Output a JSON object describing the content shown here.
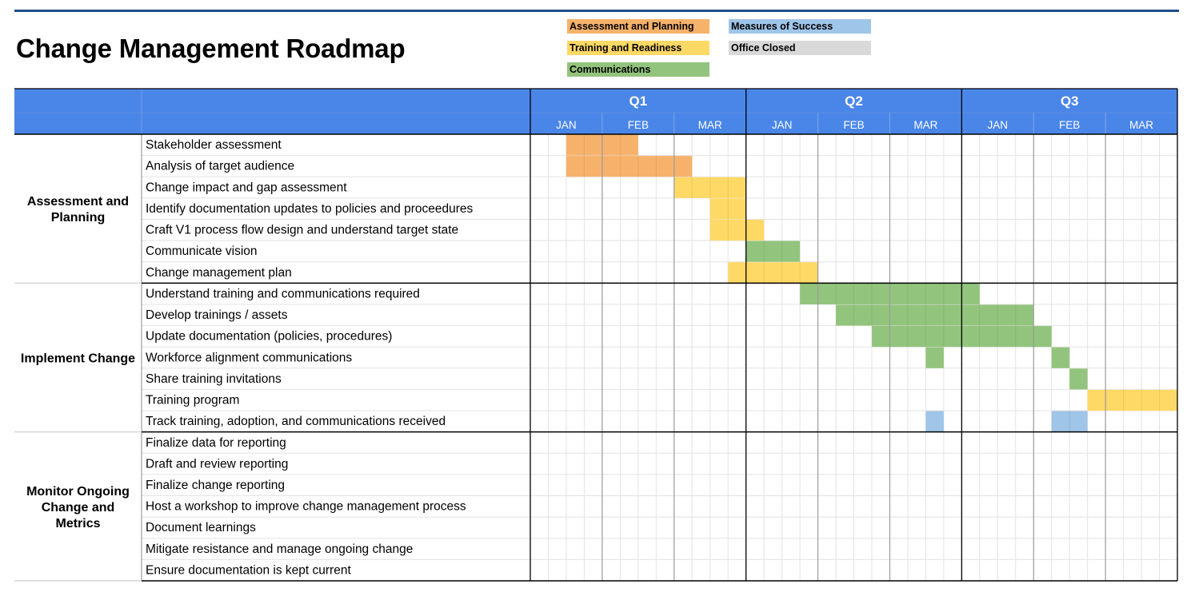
{
  "title": "Change Management Roadmap",
  "legend": [
    {
      "label": "Assessment and Planning",
      "key": "assessment",
      "color": "#f6b26b"
    },
    {
      "label": "Training and Readiness",
      "key": "training",
      "color": "#ffd966"
    },
    {
      "label": "Communications",
      "key": "communications",
      "color": "#93c47d"
    },
    {
      "label": "Measures of Success",
      "key": "measures",
      "color": "#9fc5e8"
    },
    {
      "label": "Office Closed",
      "key": "closed",
      "color": "#d9d9d9"
    }
  ],
  "colors": {
    "header_bg": "#4a86e8",
    "header_text": "#ffffff",
    "top_rule": "#1f4e8c"
  },
  "chart_data": {
    "type": "gantt",
    "title": "Change Management Roadmap",
    "time_unit": "week",
    "weeks_per_month": 4,
    "quarters": [
      {
        "label": "Q1",
        "months": [
          "JAN",
          "FEB",
          "MAR"
        ]
      },
      {
        "label": "Q2",
        "months": [
          "JAN",
          "FEB",
          "MAR"
        ]
      },
      {
        "label": "Q3",
        "months": [
          "JAN",
          "FEB",
          "MAR"
        ]
      }
    ],
    "phases": [
      {
        "label": "Assessment and Planning",
        "tasks": [
          {
            "label": "Stakeholder assessment",
            "bars": [
              {
                "start": 2,
                "end": 5,
                "category": "assessment"
              }
            ]
          },
          {
            "label": "Analysis of target audience",
            "bars": [
              {
                "start": 2,
                "end": 8,
                "category": "assessment"
              }
            ]
          },
          {
            "label": "Change impact and gap assessment",
            "bars": [
              {
                "start": 8,
                "end": 11,
                "category": "training"
              }
            ]
          },
          {
            "label": "Identify documentation updates to policies and proceedures",
            "bars": [
              {
                "start": 10,
                "end": 11,
                "category": "training"
              }
            ]
          },
          {
            "label": "Craft V1 process flow design and understand target state",
            "bars": [
              {
                "start": 10,
                "end": 12,
                "category": "training"
              }
            ]
          },
          {
            "label": "Communicate vision",
            "bars": [
              {
                "start": 12,
                "end": 14,
                "category": "communications"
              }
            ]
          },
          {
            "label": "Change management plan",
            "bars": [
              {
                "start": 11,
                "end": 15,
                "category": "training"
              }
            ]
          }
        ]
      },
      {
        "label": "Implement Change",
        "tasks": [
          {
            "label": "Understand training and communications required",
            "bars": [
              {
                "start": 15,
                "end": 24,
                "category": "communications"
              }
            ]
          },
          {
            "label": "Develop trainings / assets",
            "bars": [
              {
                "start": 17,
                "end": 27,
                "category": "communications"
              }
            ]
          },
          {
            "label": "Update documentation (policies, procedures)",
            "bars": [
              {
                "start": 19,
                "end": 28,
                "category": "communications"
              }
            ]
          },
          {
            "label": "Workforce alignment communications",
            "bars": [
              {
                "start": 22,
                "end": 22,
                "category": "communications"
              },
              {
                "start": 29,
                "end": 29,
                "category": "communications"
              }
            ]
          },
          {
            "label": "Share training invitations",
            "bars": [
              {
                "start": 30,
                "end": 30,
                "category": "communications"
              }
            ]
          },
          {
            "label": "Training program",
            "bars": [
              {
                "start": 31,
                "end": 35,
                "category": "training"
              }
            ]
          },
          {
            "label": "Track training, adoption, and communications received",
            "bars": [
              {
                "start": 22,
                "end": 22,
                "category": "measures"
              },
              {
                "start": 29,
                "end": 30,
                "category": "measures"
              }
            ]
          }
        ]
      },
      {
        "label": "Monitor Ongoing Change and Metrics",
        "tasks": [
          {
            "label": "Finalize data for reporting",
            "bars": []
          },
          {
            "label": "Draft and review reporting",
            "bars": []
          },
          {
            "label": "Finalize change reporting",
            "bars": []
          },
          {
            "label": "Host a workshop to improve change management process",
            "bars": []
          },
          {
            "label": "Document learnings",
            "bars": []
          },
          {
            "label": "Mitigate resistance and manage ongoing change",
            "bars": []
          },
          {
            "label": "Ensure documentation is kept current",
            "bars": []
          }
        ]
      }
    ]
  }
}
